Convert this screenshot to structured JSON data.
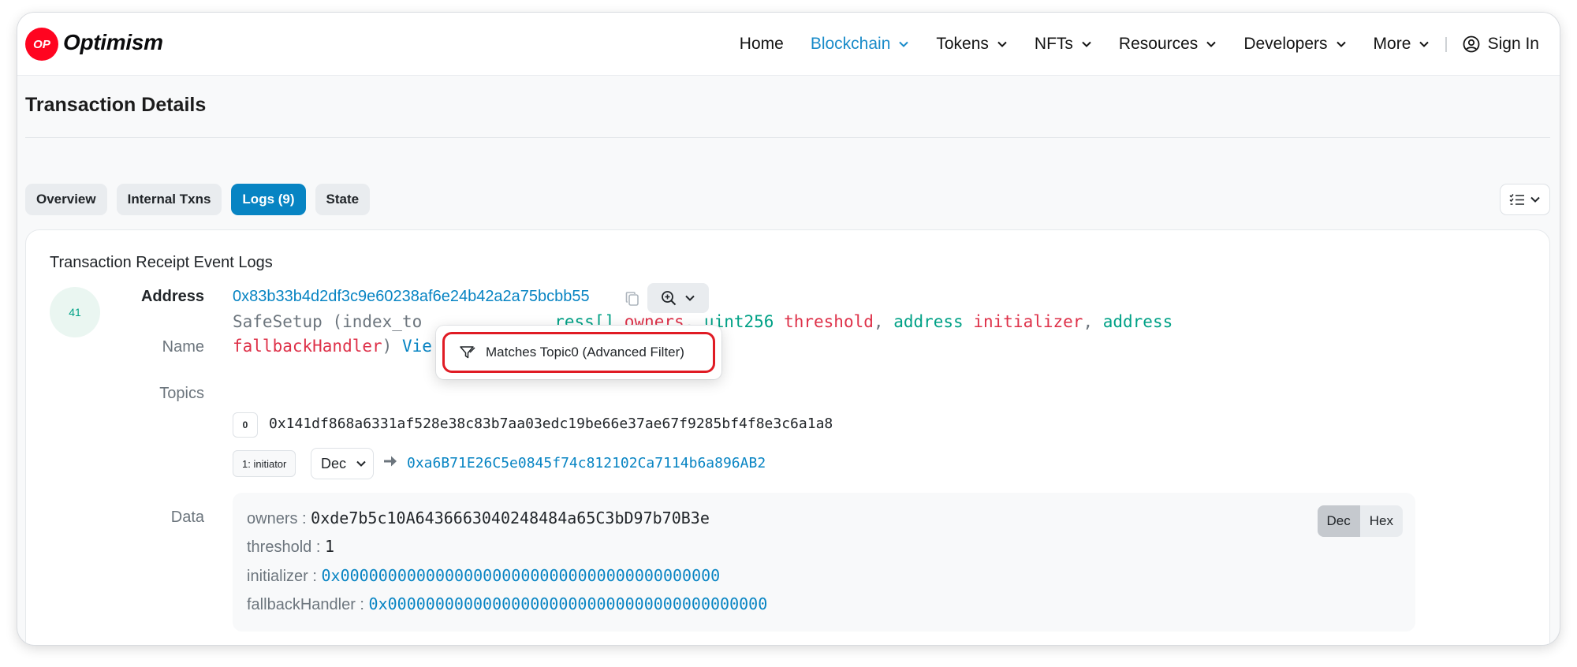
{
  "brand": {
    "logo_mark": "OP",
    "name": "Optimism"
  },
  "nav": {
    "items": [
      {
        "label": "Home",
        "has_dropdown": false,
        "active": false
      },
      {
        "label": "Blockchain",
        "has_dropdown": true,
        "active": true
      },
      {
        "label": "Tokens",
        "has_dropdown": true,
        "active": false
      },
      {
        "label": "NFTs",
        "has_dropdown": true,
        "active": false
      },
      {
        "label": "Resources",
        "has_dropdown": true,
        "active": false
      },
      {
        "label": "Developers",
        "has_dropdown": true,
        "active": false
      },
      {
        "label": "More",
        "has_dropdown": true,
        "active": false
      }
    ],
    "separator": "|",
    "sign_in": "Sign In"
  },
  "page": {
    "title": "Transaction Details"
  },
  "tabs": [
    {
      "label": "Overview",
      "active": false
    },
    {
      "label": "Internal Txns",
      "active": false
    },
    {
      "label": "Logs (9)",
      "active": true
    },
    {
      "label": "State",
      "active": false
    }
  ],
  "log_card": {
    "title": "Transaction Receipt Event Logs",
    "log_index": "41",
    "address_label": "Address",
    "address": "0x83b33b4d2df3c9e60238af6e24b42a2a75bcbb55",
    "name_label": "Name",
    "event": {
      "name": "SafeSetup",
      "paren_open": " (",
      "first_param_visible": "index_to",
      "hidden_prefix": "ress[] ",
      "owners": "owners",
      "comma": ", ",
      "uint256": "uint256",
      "threshold": "threshold",
      "address_kw": "address",
      "initializer": "initializer",
      "fallbackHandler": "fallbackHandler",
      "paren_close": ")",
      "view_text": "Vie"
    },
    "dropdown_option": "Matches Topic0 (Advanced Filter)",
    "topics_label": "Topics",
    "topics": [
      {
        "index": "0",
        "value": "0x141df868a6331af528e38c83b7aa03edc19be66e37ae67f9285bf4f8e3c6a1a8"
      },
      {
        "index": "1: initiator",
        "format": "Dec",
        "value": "0xa6B71E26C5e0845f74c812102Ca7114b6a896AB2"
      }
    ],
    "data_label": "Data",
    "data": [
      {
        "key": "owners : ",
        "value": "0xde7b5c10A6436663040248484a65C3bD97b70B3e",
        "is_link": false
      },
      {
        "key": "threshold : ",
        "value": "1",
        "is_link": false
      },
      {
        "key": "initializer : ",
        "value": "0x0000000000000000000000000000000000000000",
        "is_link": true
      },
      {
        "key": "fallbackHandler : ",
        "value": "0x0000000000000000000000000000000000000000",
        "is_link": true
      }
    ],
    "format_toggle": {
      "dec": "Dec",
      "hex": "Hex",
      "selected": "Dec"
    }
  },
  "colors": {
    "brand_red": "#ff0420",
    "primary_blue": "#0784c3",
    "nav_active": "#1a8bc9",
    "type_green": "#00a186",
    "param_red": "#de3149",
    "highlight_red": "#e01b24"
  }
}
